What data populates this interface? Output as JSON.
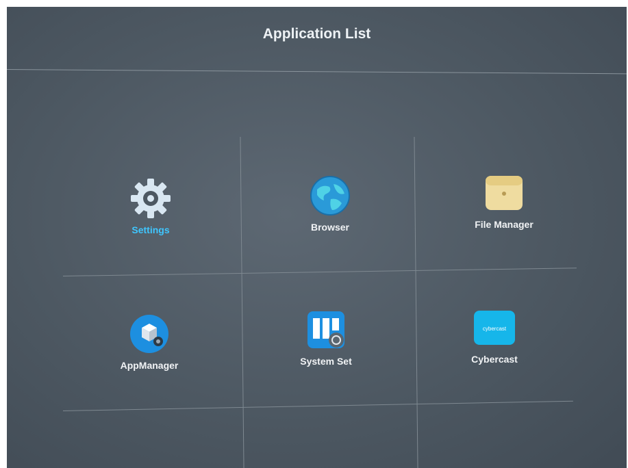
{
  "header": {
    "title": "Application List"
  },
  "apps": [
    {
      "label": "Settings",
      "icon": "gear-icon",
      "selected": true
    },
    {
      "label": "Browser",
      "icon": "globe-icon",
      "selected": false
    },
    {
      "label": "File Manager",
      "icon": "folder-icon",
      "selected": false
    },
    {
      "label": "AppManager",
      "icon": "app-manager-icon",
      "selected": false
    },
    {
      "label": "System Set",
      "icon": "system-set-icon",
      "selected": false
    },
    {
      "label": "Cybercast",
      "icon": "cybercast-icon",
      "selected": false
    }
  ],
  "cybercast_icon_text": "cybercast",
  "colors": {
    "selected_label": "#3fc6ff",
    "background": "#4d5862"
  }
}
